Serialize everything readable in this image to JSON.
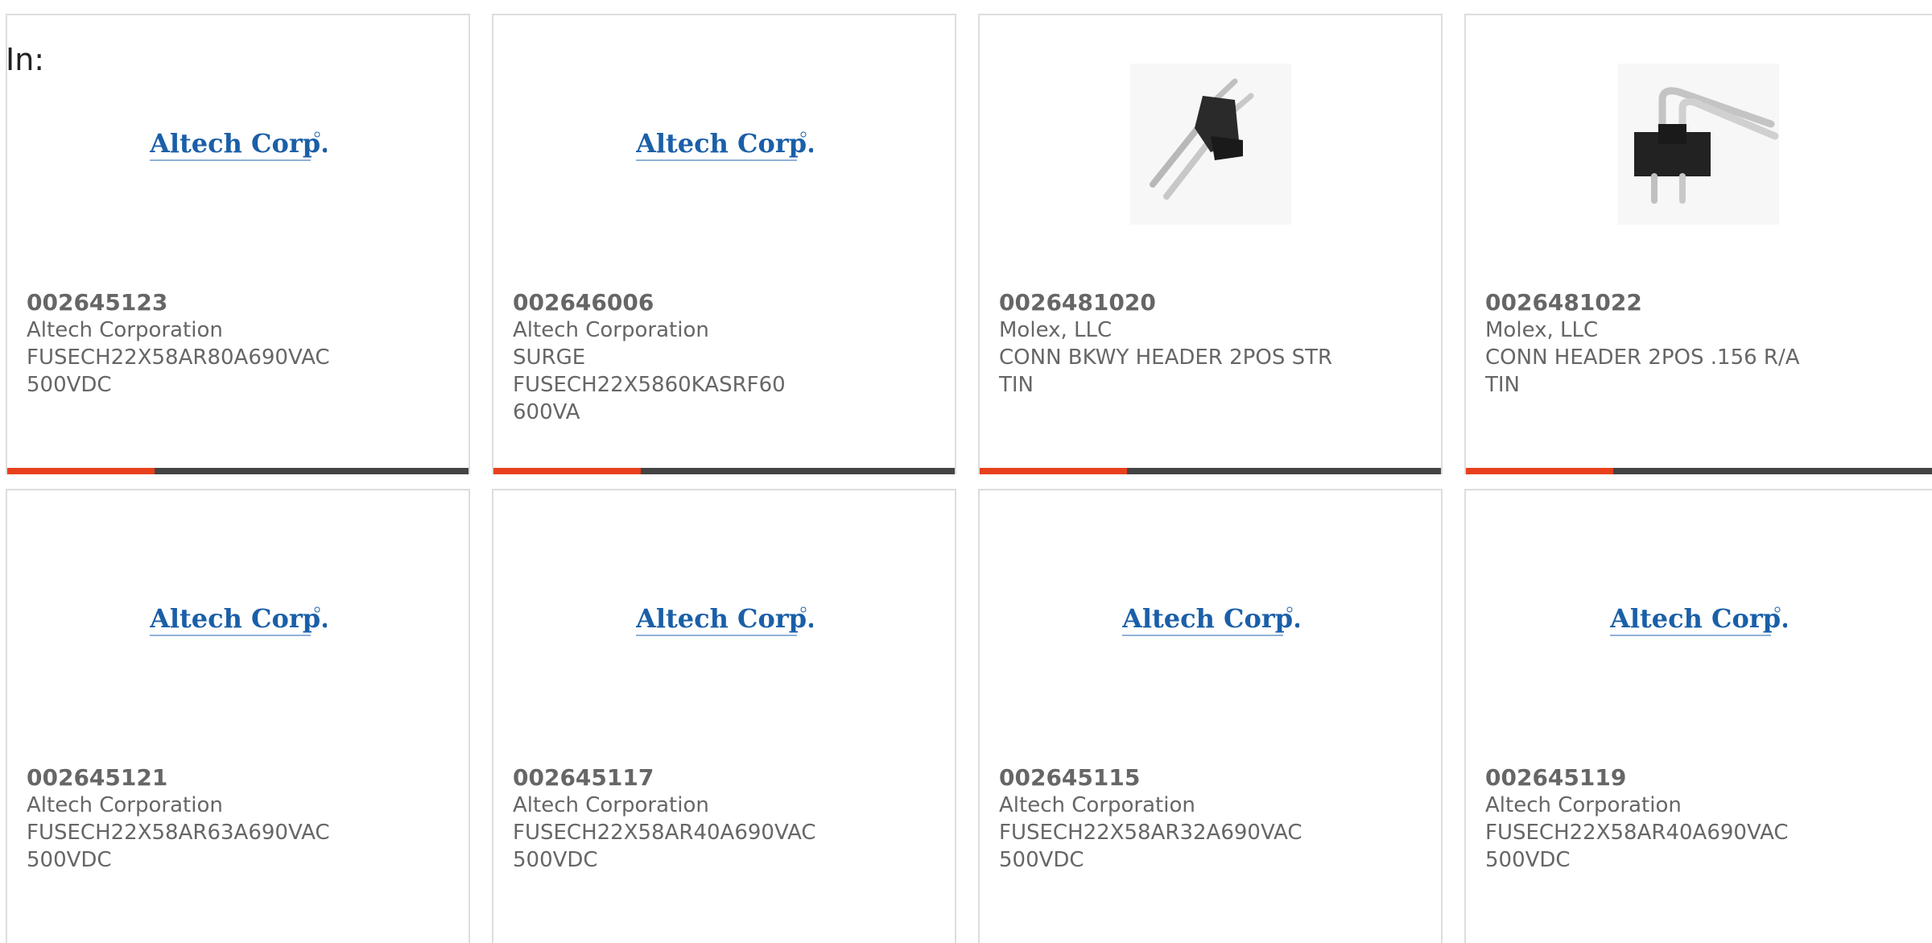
{
  "header": {
    "in_label": "In:"
  },
  "products": [
    {
      "part_number": "002645123",
      "manufacturer": "Altech Corporation",
      "desc_line1": "FUSECH22X58AR80A690VAC",
      "desc_line2": "500VDC",
      "image": "altech-logo"
    },
    {
      "part_number": "002646006",
      "manufacturer": "Altech Corporation",
      "desc_line1": "SURGE FUSECH22X5860KASRF60",
      "desc_line2": "600VA",
      "image": "altech-logo"
    },
    {
      "part_number": "0026481020",
      "manufacturer": "Molex, LLC",
      "desc_line1": "CONN BKWY HEADER 2POS STR",
      "desc_line2": "TIN",
      "image": "straight-header-photo"
    },
    {
      "part_number": "0026481022",
      "manufacturer": "Molex, LLC",
      "desc_line1": "CONN HEADER 2POS .156 R/A",
      "desc_line2": "TIN",
      "image": "right-angle-header-photo"
    },
    {
      "part_number": "002645121",
      "manufacturer": "Altech Corporation",
      "desc_line1": "FUSECH22X58AR63A690VAC",
      "desc_line2": "500VDC",
      "image": "altech-logo"
    },
    {
      "part_number": "002645117",
      "manufacturer": "Altech Corporation",
      "desc_line1": "FUSECH22X58AR40A690VAC",
      "desc_line2": "500VDC",
      "image": "altech-logo"
    },
    {
      "part_number": "002645115",
      "manufacturer": "Altech Corporation",
      "desc_line1": "FUSECH22X58AR32A690VAC",
      "desc_line2": "500VDC",
      "image": "altech-logo"
    },
    {
      "part_number": "002645119",
      "manufacturer": "Altech Corporation",
      "desc_line1": "FUSECH22X58AR40A690VAC",
      "desc_line2": "500VDC",
      "image": "altech-logo"
    }
  ],
  "logo_text": "Altech Corp.",
  "colors": {
    "accent": "#e8401c",
    "bar": "#444444",
    "logo_blue": "#1a5fa8",
    "text": "#666666"
  }
}
